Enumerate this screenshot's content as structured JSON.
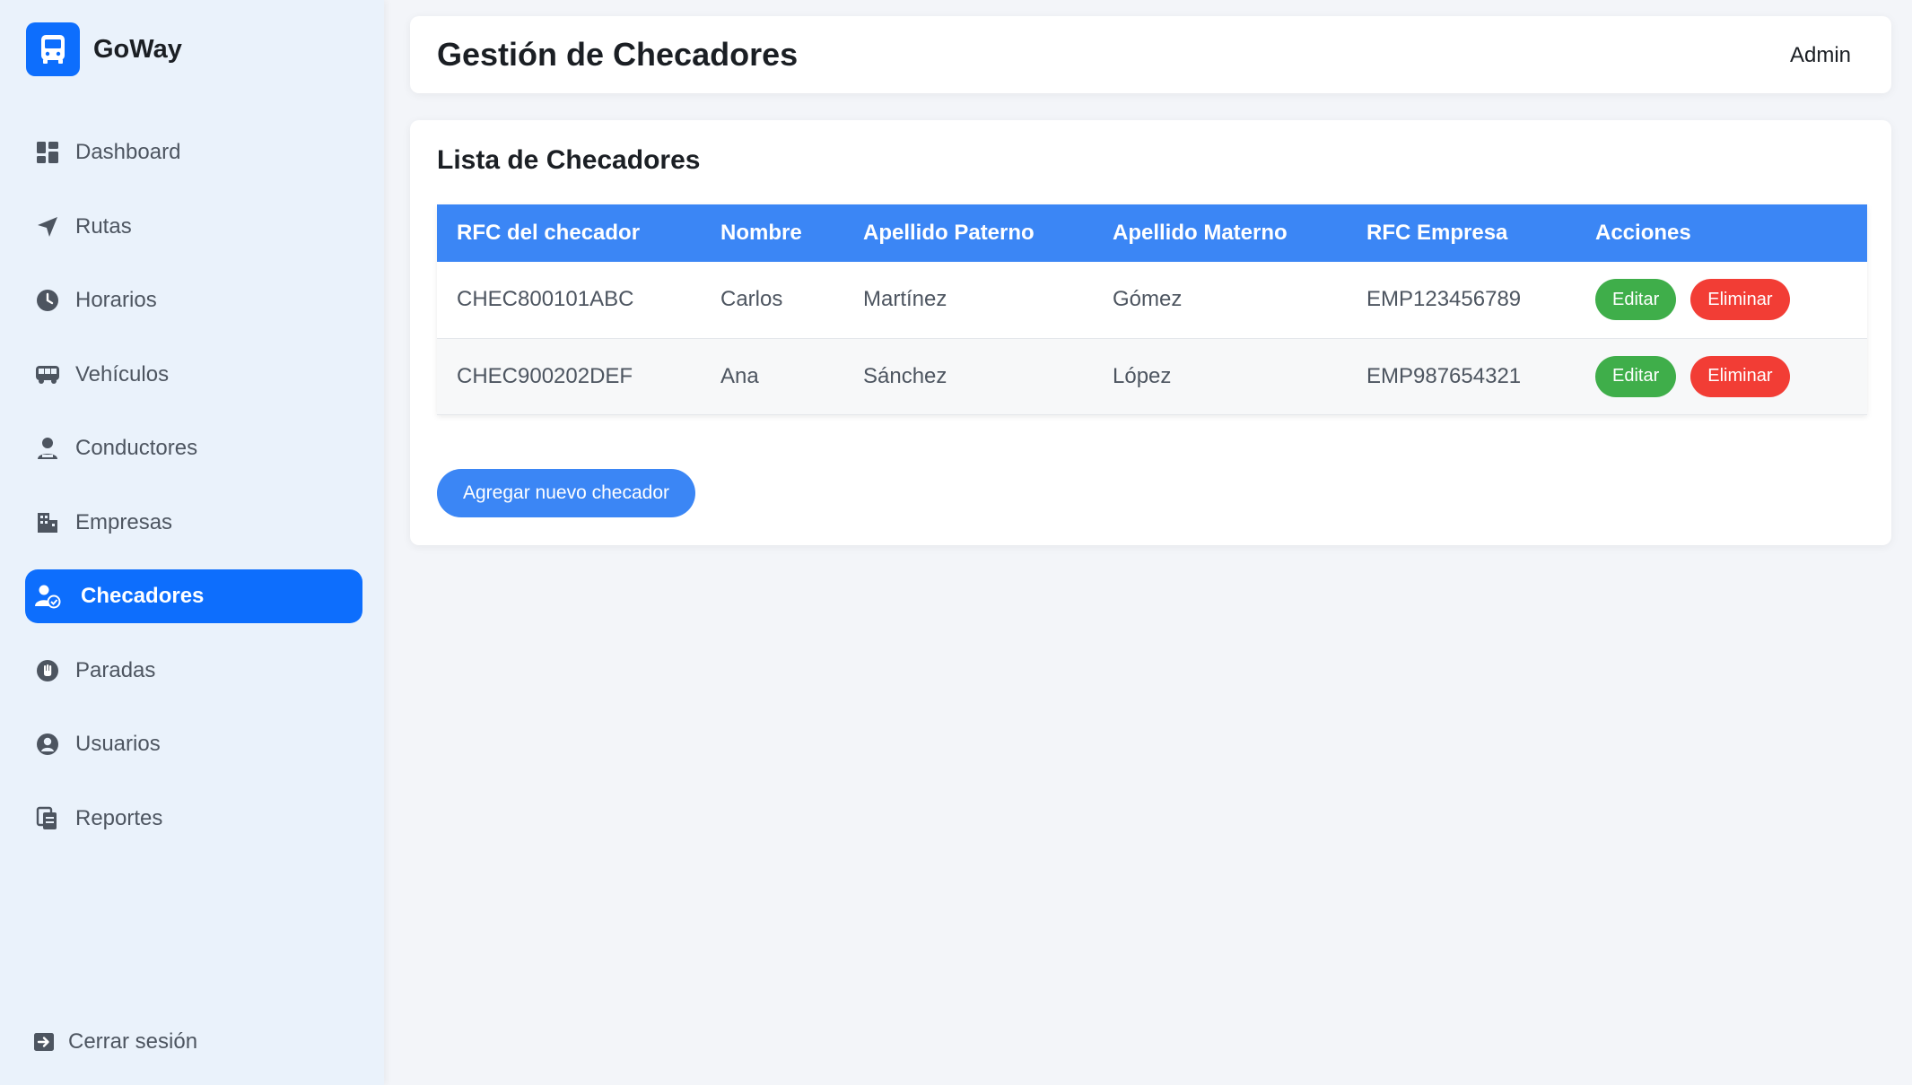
{
  "brand": {
    "name": "GoWay",
    "logo_icon": "bus-icon",
    "color": "#0d6efd"
  },
  "sidebar": {
    "items": [
      {
        "label": "Dashboard",
        "icon": "dashboard-icon",
        "active": false
      },
      {
        "label": "Rutas",
        "icon": "navigation-arrow-icon",
        "active": false
      },
      {
        "label": "Horarios",
        "icon": "clock-icon",
        "active": false
      },
      {
        "label": "Vehículos",
        "icon": "bus-icon",
        "active": false
      },
      {
        "label": "Conductores",
        "icon": "driver-icon",
        "active": false
      },
      {
        "label": "Empresas",
        "icon": "building-icon",
        "active": false
      },
      {
        "label": "Checadores",
        "icon": "user-check-icon",
        "active": true
      },
      {
        "label": "Paradas",
        "icon": "hand-stop-icon",
        "active": false
      },
      {
        "label": "Usuarios",
        "icon": "user-circle-icon",
        "active": false
      },
      {
        "label": "Reportes",
        "icon": "document-copy-icon",
        "active": false
      }
    ],
    "logout": {
      "label": "Cerrar sesión",
      "icon": "logout-icon"
    }
  },
  "header": {
    "title": "Gestión de Checadores",
    "user": "Admin"
  },
  "main": {
    "card_title": "Lista de Checadores",
    "table": {
      "columns": [
        "RFC del checador",
        "Nombre",
        "Apellido Paterno",
        "Apellido Materno",
        "RFC Empresa",
        "Acciones"
      ],
      "rows": [
        {
          "rfc": "CHEC800101ABC",
          "nombre": "Carlos",
          "paterno": "Martínez",
          "materno": "Gómez",
          "empresa": "EMP123456789"
        },
        {
          "rfc": "CHEC900202DEF",
          "nombre": "Ana",
          "paterno": "Sánchez",
          "materno": "López",
          "empresa": "EMP987654321"
        }
      ],
      "edit_label": "Editar",
      "delete_label": "Eliminar"
    },
    "add_button": "Agregar nuevo checador"
  },
  "colors": {
    "primary": "#0d6efd",
    "table_header": "#3b86f5",
    "edit": "#3fae4a",
    "delete": "#f23d35",
    "sidebar_bg": "#eaf2fb"
  }
}
